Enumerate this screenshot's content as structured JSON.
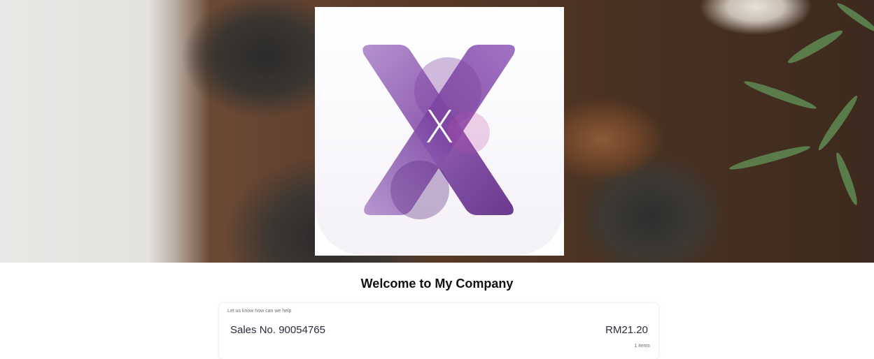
{
  "hero": {
    "logo_letter": "X",
    "logo_colors": {
      "primary": "#8e5bb0",
      "dark": "#6a3a8e",
      "light": "#b18fcc"
    }
  },
  "welcome": {
    "title": "Welcome to My Company"
  },
  "order_card": {
    "hint": "Let us know how can we help",
    "sales_label": "Sales No. 90054765",
    "amount": "RM21.20",
    "items_count": "1 items"
  }
}
